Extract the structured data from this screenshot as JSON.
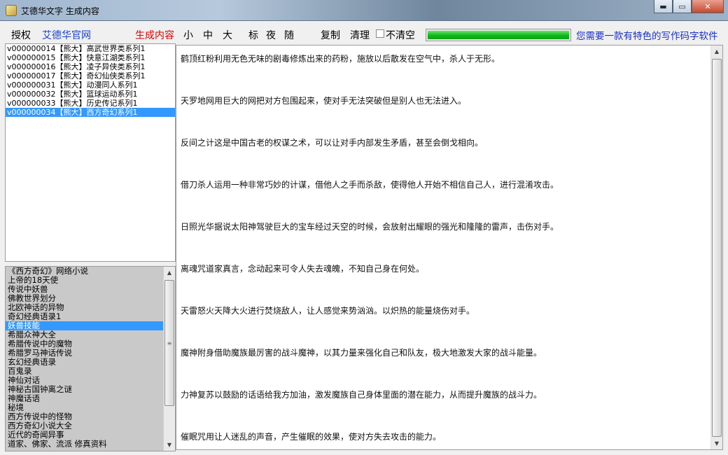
{
  "window": {
    "title": "艾德华文字 生成内容",
    "minimize_label": "▬",
    "maximize_label": "▭",
    "close_label": "✕"
  },
  "toolbar": {
    "authorize": "授权",
    "official_site": "艾德华官网",
    "generate": "生成内容",
    "size_small": "小",
    "size_medium": "中",
    "size_large": "大",
    "style_standard": "标",
    "style_night": "夜",
    "style_random": "随",
    "copy": "复制",
    "clear": "清理",
    "no_clear_label": "不清空",
    "no_clear_checked": false,
    "progress_percent": 100,
    "slogan": "您需要一款有特色的写作码字软件"
  },
  "series_list": {
    "items": [
      "v000000014【熊大】高武世界类系列1",
      "v000000015【熊大】快意江湖类系列1",
      "v000000016【熊大】凌子异侠类系列1",
      "v000000017【熊大】奇幻仙侠类系列1",
      "v000000031【熊大】动漫同人系列1",
      "v000000032【熊大】篮球运动系列1",
      "v000000033【熊大】历史传记系列1",
      "v000000034【熊大】西方奇幻系列1"
    ],
    "selected_index": 7
  },
  "topic_list": {
    "items": [
      "《西方奇幻》网络小说",
      "上帝的18天使",
      "传说中妖兽",
      "佛教世界划分",
      "北欧神话的异物",
      "奇幻经典语录1",
      "妖兽技能",
      "希腊众神大全",
      "希腊传说中的魔物",
      "希腊罗马神话传说",
      "玄幻经典语录",
      "百鬼录",
      "神仙对话",
      "神秘古国钟离之谜",
      "神魔话语",
      "秘境",
      "西方传说中的怪物",
      "西方奇幻小说大全",
      "近代的奇闻异事",
      "道家、佛家、流派 修真资料"
    ],
    "selected_index": 6
  },
  "content": {
    "paragraphs": [
      "鹤顶红粉利用无色无味的剧毒修炼出来的药粉，施放以后散发在空气中，杀人于无形。",
      "天罗地网用巨大的网把对方包围起来，使对手无法突破但是别人也无法进入。",
      "反间之计这是中国古老的权谋之术，可以让对手内部发生矛盾，甚至会倒戈相向。",
      "借刀杀人运用一种非常巧妙的计谋，借他人之手而杀敌，使得他人开始不相信自己人，进行混淆攻击。",
      "日照光华据说太阳神驾驶巨大的宝车经过天空的时候，会放射出耀眼的强光和隆隆的雷声，击伤对手。",
      "离魂咒道家真言，念动起来可令人失去魂魄，不知自己身在何处。",
      "天雷怒火天降大火进行焚烧敌人，让人感觉来势汹汹。以炽热的能量烧伤对手。",
      "魔神附身借助魔族最厉害的战斗魔神，以其力量来强化自己和队友，极大地激发大家的战斗能量。",
      "力神复苏以鼓励的话语给我方加油，激发魔族自己身体里面的潜在能力，从而提升魔族的战斗力。",
      "催眠咒用让人迷乱的声音，产生催眠的效果，使对方失去攻击的能力。"
    ]
  },
  "scrollbar": {
    "up_arrow": "▲",
    "down_arrow": "▼",
    "grip": "≡"
  }
}
